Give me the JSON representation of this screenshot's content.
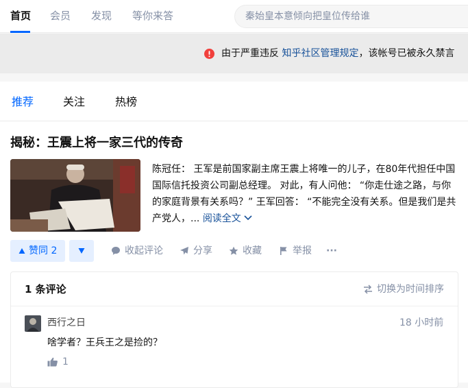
{
  "topnav": {
    "tabs": [
      {
        "label": "首页",
        "active": true
      },
      {
        "label": "会员",
        "active": false
      },
      {
        "label": "发现",
        "active": false
      },
      {
        "label": "等你来答",
        "active": false
      }
    ],
    "search_placeholder": "秦始皇本意倾向把皇位传给谁"
  },
  "banner": {
    "text_before": "由于严重违反 ",
    "link": "知乎社区管理规定",
    "text_after": "，该帐号已被永久禁言",
    "icon": "warning-circle-icon",
    "icon_color": "#f1403c"
  },
  "feed_tabs": [
    {
      "label": "推荐",
      "active": true
    },
    {
      "label": "关注",
      "active": false
    },
    {
      "label": "热榜",
      "active": false
    }
  ],
  "article": {
    "title": "揭秘：王震上将一家三代的传奇",
    "excerpt": "陈冠任： 王军是前国家副主席王震上将唯一的儿子，在80年代担任中国国际信托投资公司副总经理。 对此，有人问他： “你走仕途之路，与你的家庭背景有关系吗？” 王军回答： “不能完全没有关系。但是我们是共产党人，...",
    "read_more": "阅读全文"
  },
  "actions": {
    "vote_up": "赞同 2",
    "comment": "收起评论",
    "share": "分享",
    "favorite": "收藏",
    "report": "举报",
    "more": "···"
  },
  "comments": {
    "count": "1 条评论",
    "sort": "切换为时间排序",
    "items": [
      {
        "user": "西行之日",
        "time": "18 小时前",
        "text": "啥学者？王兵王之是捡的？",
        "likes": "1"
      }
    ]
  },
  "colors": {
    "accent": "#0066ff",
    "link": "#175199",
    "muted": "#8590a6"
  }
}
